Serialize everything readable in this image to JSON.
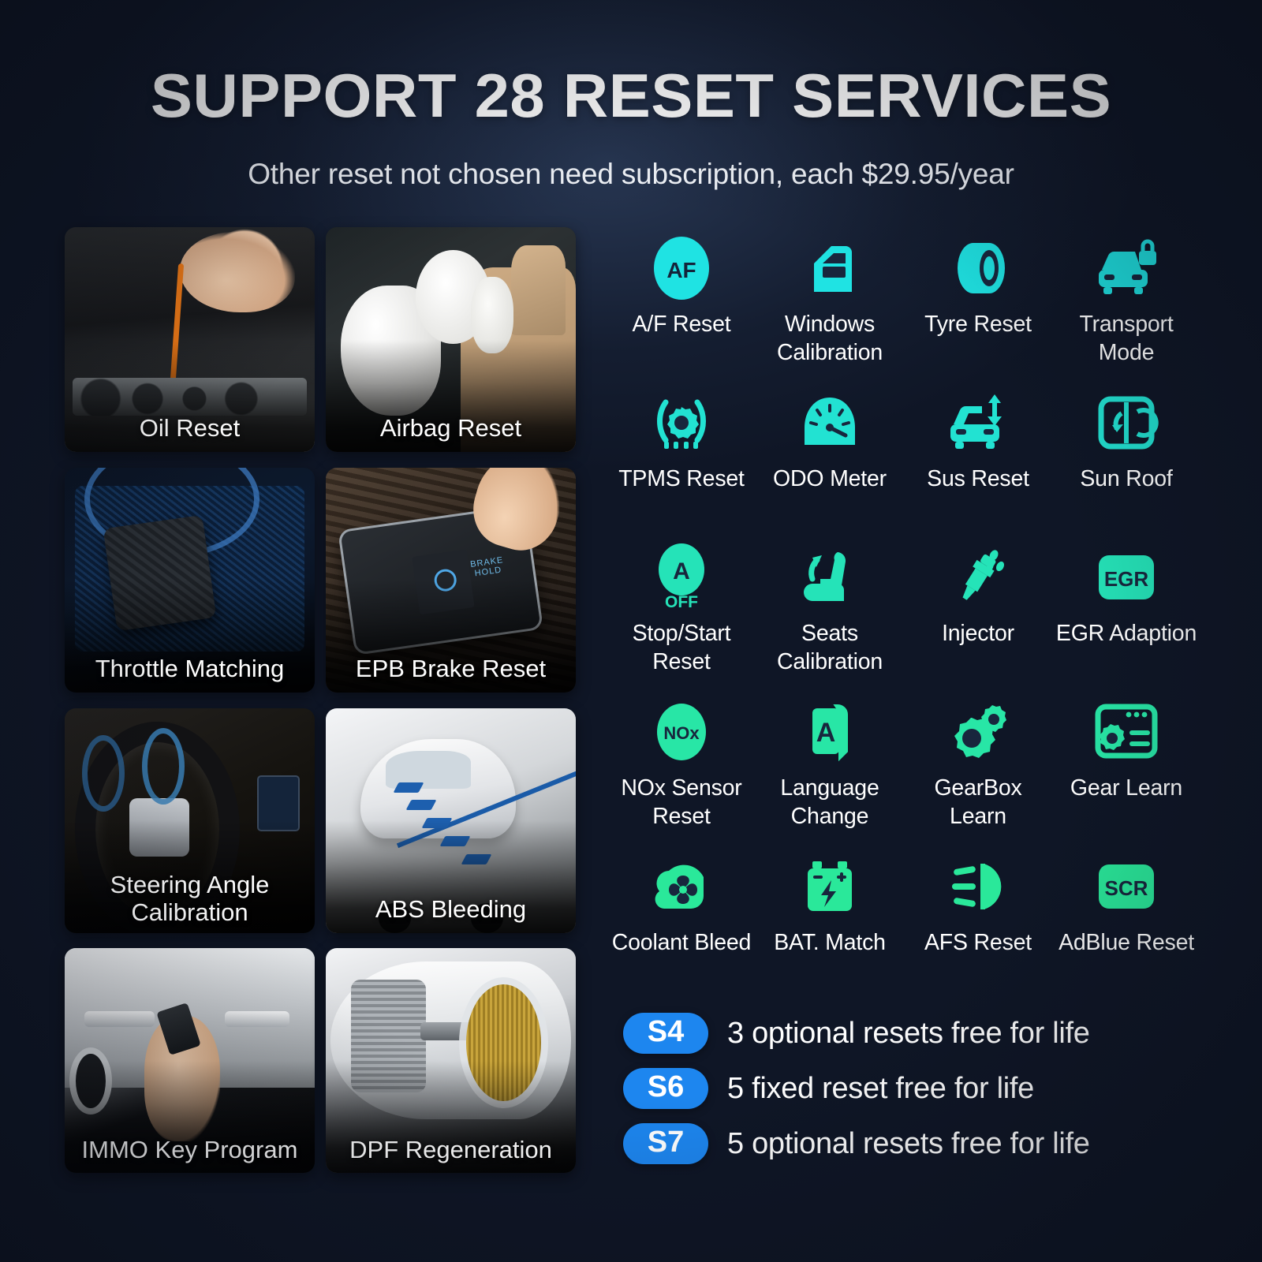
{
  "header": {
    "title": "SUPPORT 28 RESET SERVICES",
    "subtitle": "Other reset not chosen need subscription, each $29.95/year"
  },
  "colors": {
    "background_dark": "#121a2b",
    "background_light": "#26344f",
    "icon_cyan": "#1fe3e3",
    "icon_teal": "#25e0c0",
    "icon_green": "#2ae89a",
    "badge_blue": "#1d86ef",
    "text_white": "#ffffff"
  },
  "photos": [
    {
      "label": "Oil Reset",
      "icon": "engine-oil-dipstick-photo"
    },
    {
      "label": "Airbag Reset",
      "icon": "deployed-airbags-photo"
    },
    {
      "label": "Throttle Matching",
      "icon": "accelerator-pedal-photo"
    },
    {
      "label": "EPB Brake Reset",
      "icon": "electronic-parking-brake-switch-photo"
    },
    {
      "label": "Steering Angle Calibration",
      "icon": "steering-wheel-photo"
    },
    {
      "label": "ABS Bleeding",
      "icon": "car-braking-trajectory-photo"
    },
    {
      "label": "IMMO Key Program",
      "icon": "car-key-fob-photo"
    },
    {
      "label": "DPF Regeneration",
      "icon": "diesel-particulate-filter-photo"
    }
  ],
  "services": [
    {
      "label": "A/F Reset",
      "icon": "af-badge-icon",
      "color": "#1fe3e3",
      "badge_text": "AF"
    },
    {
      "label": "Windows Calibration",
      "icon": "car-door-window-icon",
      "color": "#1fe3e3"
    },
    {
      "label": "Tyre Reset",
      "icon": "tyre-icon",
      "color": "#1fe3e3"
    },
    {
      "label": "Transport Mode",
      "icon": "car-lock-icon",
      "color": "#1fe3e3"
    },
    {
      "label": "TPMS Reset",
      "icon": "tyre-pressure-gear-icon",
      "color": "#22e2d2"
    },
    {
      "label": "ODO Meter",
      "icon": "odometer-gauge-icon",
      "color": "#22e2d2"
    },
    {
      "label": "Sus Reset",
      "icon": "car-suspension-arrow-icon",
      "color": "#22e2d2"
    },
    {
      "label": "Sun Roof",
      "icon": "sun-roof-icon",
      "color": "#22e2d2"
    },
    {
      "label": "Stop/Start Reset",
      "icon": "auto-stop-start-off-icon",
      "color": "#25e3b8",
      "badge_text": "A",
      "badge_sub": "OFF"
    },
    {
      "label": "Seats Calibration",
      "icon": "car-seat-arrow-icon",
      "color": "#25e3b8"
    },
    {
      "label": "Injector",
      "icon": "fuel-injector-icon",
      "color": "#25e3b8"
    },
    {
      "label": "EGR Adaption",
      "icon": "egr-badge-icon",
      "color": "#25e3b8",
      "badge_text": "EGR"
    },
    {
      "label": "NOx Sensor Reset",
      "icon": "nox-sensor-badge-icon",
      "color": "#28e6a6",
      "badge_text": "NOx"
    },
    {
      "label": "Language Change",
      "icon": "language-book-icon",
      "color": "#28e6a6",
      "badge_text": "A"
    },
    {
      "label": "GearBox Learn",
      "icon": "gearbox-gears-icon",
      "color": "#28e6a6"
    },
    {
      "label": "Gear Learn",
      "icon": "gear-learn-window-icon",
      "color": "#28e6a6"
    },
    {
      "label": "Coolant Bleed",
      "icon": "coolant-fan-icon",
      "color": "#2ae89a"
    },
    {
      "label": "BAT. Match",
      "icon": "battery-icon",
      "color": "#2ae89a"
    },
    {
      "label": "AFS Reset",
      "icon": "headlight-beam-icon",
      "color": "#2ae89a"
    },
    {
      "label": "AdBlue Reset",
      "icon": "scr-badge-icon",
      "color": "#2ae89a",
      "badge_text": "SCR"
    }
  ],
  "plans": [
    {
      "code": "S4",
      "description": "3 optional resets free for life"
    },
    {
      "code": "S6",
      "description": "5 fixed reset free for life"
    },
    {
      "code": "S7",
      "description": "5 optional resets free for life"
    }
  ]
}
